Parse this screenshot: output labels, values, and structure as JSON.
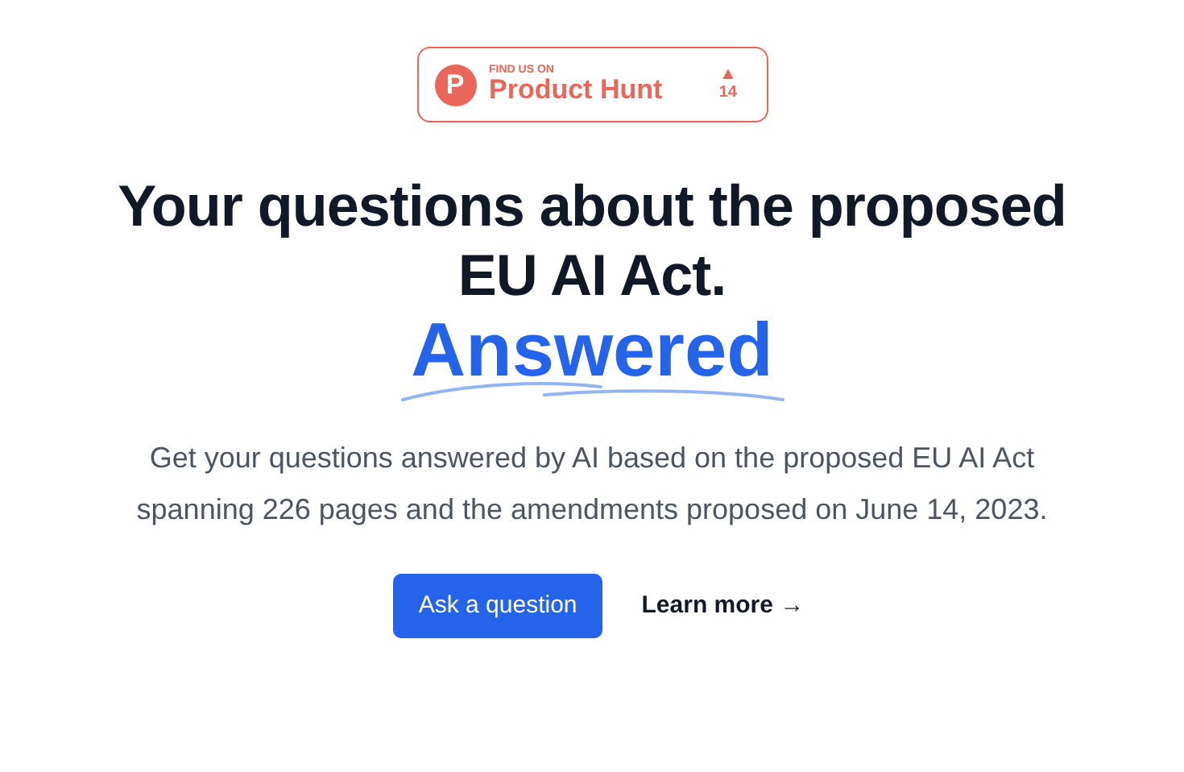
{
  "badge": {
    "logo_letter": "P",
    "caption": "FIND US ON",
    "name": "Product Hunt",
    "upvote_arrow": "▲",
    "votes": "14"
  },
  "headline": {
    "line_1": "Your questions about the proposed",
    "line_2": "EU AI Act.",
    "highlight": "Answered"
  },
  "description": "Get your questions answered by AI based on the proposed EU AI Act spanning 226 pages and the amendments proposed on June 14, 2023.",
  "buttons": [
    {
      "kind": "primary",
      "label": "Ask a question"
    },
    {
      "kind": "link",
      "label": "Learn more →"
    }
  ]
}
